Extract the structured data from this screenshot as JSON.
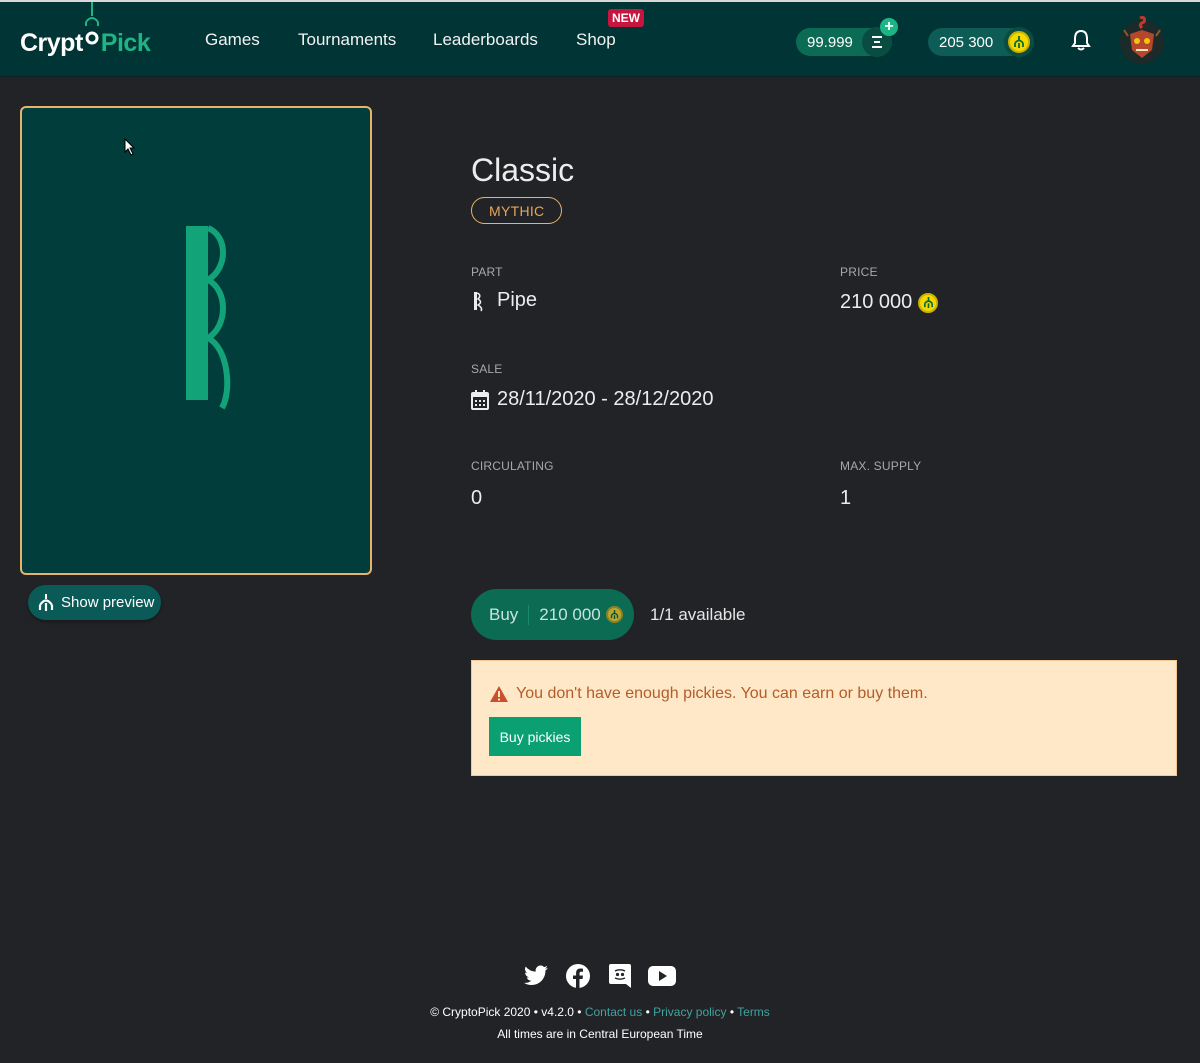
{
  "header": {
    "logo_part1": "Crypt",
    "logo_part2": "Pick",
    "nav": [
      "Games",
      "Tournaments",
      "Leaderboards",
      "Shop"
    ],
    "new_badge": "NEW",
    "balance_primary": "99.999",
    "balance_pickies": "205 300",
    "icons": {
      "logo": "claw-icon",
      "menu": "menu-icon",
      "add": "plus-icon",
      "coin": "pickie-coin-icon",
      "bell": "bell-icon",
      "avatar": "mask-avatar"
    }
  },
  "item": {
    "title": "Classic",
    "rarity": "MYTHIC",
    "part_label": "PART",
    "part_value": "Pipe",
    "price_label": "PRICE",
    "price_value": "210 000",
    "sale_label": "SALE",
    "sale_value": "28/11/2020 - 28/12/2020",
    "circulating_label": "CIRCULATING",
    "circulating_value": "0",
    "max_supply_label": "MAX. SUPPLY",
    "max_supply_value": "1"
  },
  "preview": {
    "button_label": "Show preview"
  },
  "purchase": {
    "buy_label": "Buy",
    "buy_amount": "210 000",
    "available": "1/1 available"
  },
  "alert": {
    "message": "You don't have enough pickies. You can earn or buy them.",
    "button_label": "Buy pickies"
  },
  "footer": {
    "copyright": "© CryptoPick 2020 • v4.2.0 •",
    "links": [
      "Contact us",
      "Privacy policy",
      "Terms"
    ],
    "timezone_note": "All times are in Central European Time"
  },
  "colors": {
    "header_bg": "#013434",
    "page_bg": "#222326",
    "accent_green": "#1db584",
    "rarity_gold": "#e7b36a",
    "alert_bg": "#ffe8c8",
    "alert_text": "#b35d2a"
  }
}
